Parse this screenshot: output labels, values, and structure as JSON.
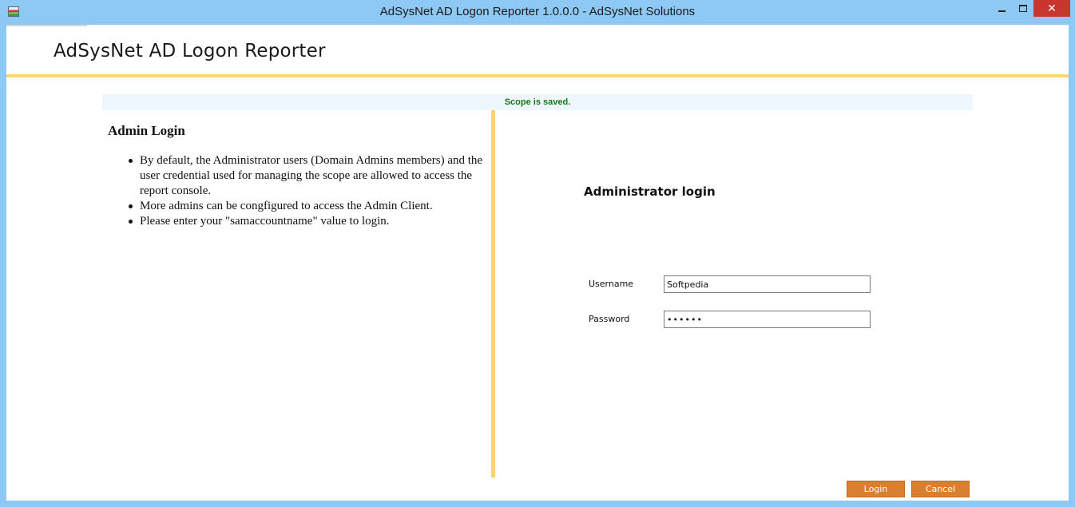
{
  "window": {
    "title": "AdSysNet AD Logon Reporter 1.0.0.0 - AdSysNet Solutions",
    "close_glyph": "✕"
  },
  "header": {
    "title": "AdSysNet AD Logon Reporter"
  },
  "status": {
    "message": "Scope is saved.",
    "color": "#117a11"
  },
  "left": {
    "heading": "Admin Login",
    "items": [
      "By default, the Administrator users (Domain Admins members) and the user credential used for managing the scope are allowed to access the report console.",
      "More admins can be congfigured to access the Admin Client.",
      "Please enter your \"samaccountname\" value to login."
    ]
  },
  "login": {
    "heading": "Administrator login",
    "username_label": "Username",
    "username_value": "Softpedia",
    "password_label": "Password",
    "password_value": "••••••",
    "login_label": "Login",
    "cancel_label": "Cancel"
  },
  "colors": {
    "accent": "#fcd17a",
    "button": "#d8802e",
    "titlebar": "#8ec8f5"
  }
}
